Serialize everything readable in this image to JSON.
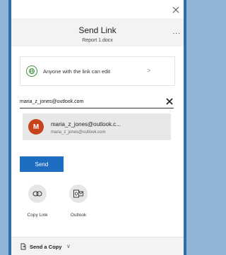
{
  "dialog": {
    "title": "Send Link",
    "subtitle": "Report 1.docx",
    "more_label": "...",
    "permission_text": "Anyone with the link can edit",
    "permission_chevron": ">",
    "email_value": "maria_z_jones@outlook.com",
    "suggestion": {
      "initial": "M",
      "name": "maria_z_jones@outlook.c...",
      "email": "maria_z_jones@outlook.com"
    },
    "send_label": "Send",
    "actions": [
      {
        "label": "Copy Link"
      },
      {
        "label": "Outlook"
      }
    ],
    "footer": {
      "label": "Send a Copy",
      "chevron": "∨"
    }
  },
  "colors": {
    "accent": "#1f6dc2",
    "avatar": "#c8431b",
    "globe": "#3b8f3b"
  },
  "icons": [
    "close-icon",
    "globe-icon",
    "clear-icon",
    "copy-link-icon",
    "outlook-icon",
    "send-copy-icon"
  ]
}
